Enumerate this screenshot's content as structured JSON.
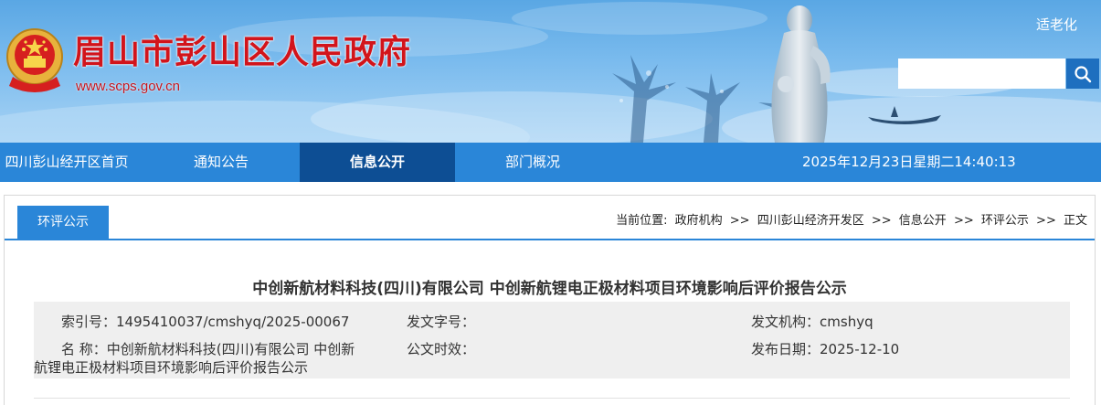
{
  "header": {
    "site_title": "眉山市彭山区人民政府",
    "site_url": "www.scps.gov.cn",
    "elderly_mode": "适老化",
    "search_placeholder": ""
  },
  "nav": {
    "items": [
      {
        "label": "四川彭山经开区首页",
        "active": false
      },
      {
        "label": "通知公告",
        "active": false
      },
      {
        "label": "信息公开",
        "active": true
      },
      {
        "label": "部门概况",
        "active": false
      }
    ],
    "datetime": "2025年12月23日星期二14:40:13"
  },
  "tab": {
    "label": "环评公示"
  },
  "breadcrumb": {
    "prefix": "当前位置:",
    "items": [
      "政府机构",
      "四川彭山经济开发区",
      "信息公开",
      "环评公示",
      "正文"
    ],
    "separator": ">>"
  },
  "article": {
    "title": "中创新航材料科技(四川)有限公司 中创新航锂电正极材料项目环境影响后评价报告公示",
    "meta": {
      "index_label": "索引号：",
      "index_value": "1495410037/cmshyq/2025-00067",
      "doc_no_label": "发文字号：",
      "doc_no_value": "",
      "issuer_label": "发文机构：",
      "issuer_value": "cmshyq",
      "name_label": "名 称：",
      "name_value_line1": "中创新航材料科技(四川)有限公司 中创新",
      "name_value_line2": "航锂电正极材料项目环境影响后评价报告公示",
      "validity_label": "公文时效：",
      "validity_value": "",
      "date_label": "发布日期：",
      "date_value": "2025-12-10"
    }
  },
  "colors": {
    "title_red": "#d2141b",
    "nav_blue": "#2a86d8",
    "nav_active": "#0d4e94",
    "meta_bg": "#efefef"
  },
  "icons": {
    "emblem": "national-emblem-icon",
    "search": "search-icon"
  }
}
